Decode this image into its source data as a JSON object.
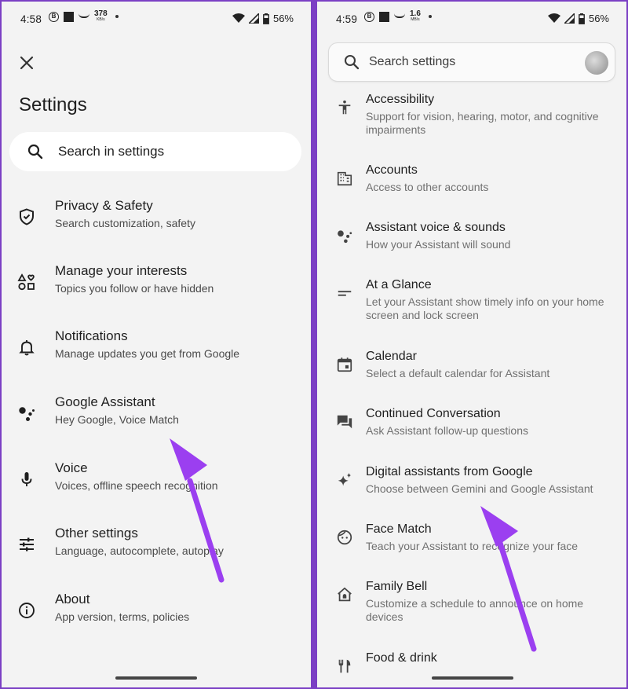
{
  "left": {
    "status": {
      "time": "4:58",
      "badge": "B",
      "speed": "378",
      "speed_unit": "KB/s",
      "battery": "56%"
    },
    "title": "Settings",
    "search_label": "Search in settings",
    "items": [
      {
        "title": "Privacy & Safety",
        "subtitle": "Search customization, safety",
        "icon": "shield-check-icon"
      },
      {
        "title": "Manage your interests",
        "subtitle": "Topics you follow or have hidden",
        "icon": "interests-icon"
      },
      {
        "title": "Notifications",
        "subtitle": "Manage updates you get from Google",
        "icon": "bell-icon"
      },
      {
        "title": "Google Assistant",
        "subtitle": "Hey Google, Voice Match",
        "icon": "assistant-icon"
      },
      {
        "title": "Voice",
        "subtitle": "Voices, offline speech recognition",
        "icon": "microphone-icon"
      },
      {
        "title": "Other settings",
        "subtitle": "Language, autocomplete, autoplay",
        "icon": "sliders-icon"
      },
      {
        "title": "About",
        "subtitle": "App version, terms, policies",
        "icon": "info-icon"
      }
    ]
  },
  "right": {
    "status": {
      "time": "4:59",
      "badge": "B",
      "speed": "1.6",
      "speed_unit": "MB/s",
      "battery": "56%"
    },
    "search_label": "Search settings",
    "items": [
      {
        "title": "Accessibility",
        "subtitle": "Support for vision, hearing, motor, and cognitive impairments",
        "icon": "accessibility-icon"
      },
      {
        "title": "Accounts",
        "subtitle": "Access to other accounts",
        "icon": "building-icon"
      },
      {
        "title": "Assistant voice & sounds",
        "subtitle": "How your Assistant will sound",
        "icon": "assistant-icon"
      },
      {
        "title": "At a Glance",
        "subtitle": "Let your Assistant show timely info on your home screen and lock screen",
        "icon": "glance-icon"
      },
      {
        "title": "Calendar",
        "subtitle": "Select a default calendar for Assistant",
        "icon": "calendar-icon"
      },
      {
        "title": "Continued Conversation",
        "subtitle": "Ask Assistant follow-up questions",
        "icon": "chat-icon"
      },
      {
        "title": "Digital assistants from Google",
        "subtitle": "Choose between Gemini and Google Assistant",
        "icon": "sparkle-icon"
      },
      {
        "title": "Face Match",
        "subtitle": "Teach your Assistant to recognize your face",
        "icon": "face-icon"
      },
      {
        "title": "Family Bell",
        "subtitle": "Customize a schedule to announce on home devices",
        "icon": "home-bell-icon"
      },
      {
        "title": "Food & drink",
        "subtitle": "",
        "icon": "fork-knife-icon"
      }
    ]
  },
  "colors": {
    "arrow": "#9b3ff0",
    "screen_bg": "#f3f3f3",
    "frame": "#7b3fc4"
  }
}
